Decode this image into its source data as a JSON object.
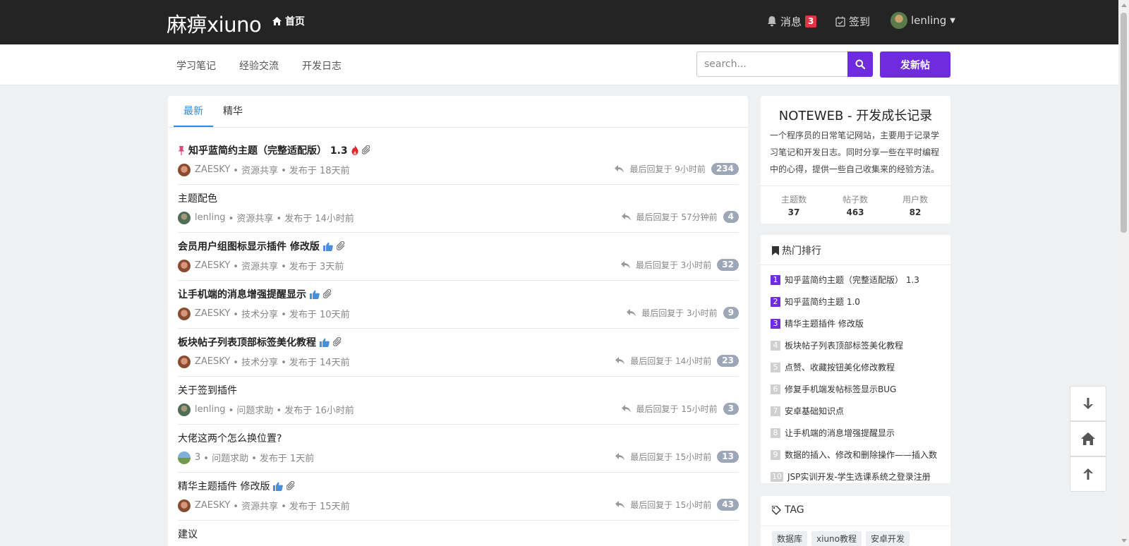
{
  "header": {
    "brand": "麻痹xiuno",
    "home_label": "首页",
    "messages_label": "消息",
    "messages_count": "3",
    "signin_label": "签到",
    "username": "lenling"
  },
  "subnav": {
    "items": [
      "学习笔记",
      "经验交流",
      "开发日志"
    ],
    "search_placeholder": "search...",
    "new_post_label": "发新帖"
  },
  "tabs": [
    "最新",
    "精华"
  ],
  "threads": [
    {
      "title": "知乎蓝简约主题（完整适配版） 1.3",
      "bold": true,
      "pinned": true,
      "hot": true,
      "attach": true,
      "thumb": false,
      "author": "ZAESKY",
      "avatar": "z",
      "forum": "• 资源共享 •",
      "posted": "发布于 18天前",
      "last_reply": "最后回复于 9小时前",
      "count": "234"
    },
    {
      "title": "主题配色",
      "bold": false,
      "pinned": false,
      "hot": false,
      "attach": false,
      "thumb": false,
      "author": "lenling",
      "avatar": "l",
      "forum": "• 资源共享 •",
      "posted": "发布于 14小时前",
      "last_reply": "最后回复于 57分钟前",
      "count": "4"
    },
    {
      "title": "会员用户组图标显示插件 修改版",
      "bold": true,
      "pinned": false,
      "hot": false,
      "attach": true,
      "thumb": true,
      "author": "ZAESKY",
      "avatar": "z",
      "forum": "• 资源共享 •",
      "posted": "发布于 3天前",
      "last_reply": "最后回复于 3小时前",
      "count": "32"
    },
    {
      "title": "让手机端的消息增强提醒显示",
      "bold": true,
      "pinned": false,
      "hot": false,
      "attach": true,
      "thumb": true,
      "author": "ZAESKY",
      "avatar": "z",
      "forum": "• 技术分享 •",
      "posted": "发布于 10天前",
      "last_reply": "最后回复于 3小时前",
      "count": "9"
    },
    {
      "title": "板块帖子列表顶部标签美化教程",
      "bold": true,
      "pinned": false,
      "hot": false,
      "attach": true,
      "thumb": true,
      "author": "ZAESKY",
      "avatar": "z",
      "forum": "• 技术分享 •",
      "posted": "发布于 14天前",
      "last_reply": "最后回复于 14小时前",
      "count": "23"
    },
    {
      "title": "关于签到插件",
      "bold": false,
      "pinned": false,
      "hot": false,
      "attach": false,
      "thumb": false,
      "author": "lenling",
      "avatar": "l",
      "forum": "• 问题求助 •",
      "posted": "发布于 16小时前",
      "last_reply": "最后回复于 15小时前",
      "count": "3"
    },
    {
      "title": "大佬这两个怎么换位置?",
      "bold": false,
      "pinned": false,
      "hot": false,
      "attach": false,
      "thumb": false,
      "author": "3",
      "avatar": "3",
      "forum": "• 问题求助 •",
      "posted": "发布于 1天前",
      "last_reply": "最后回复于 15小时前",
      "count": "13"
    },
    {
      "title": "精华主题插件 修改版",
      "bold": false,
      "pinned": false,
      "hot": false,
      "attach": true,
      "thumb": true,
      "author": "ZAESKY",
      "avatar": "z",
      "forum": "• 资源共享 •",
      "posted": "发布于 15天前",
      "last_reply": "最后回复于 15小时前",
      "count": "43"
    },
    {
      "title": "建议",
      "bold": false,
      "pinned": false,
      "hot": false,
      "attach": false,
      "thumb": false,
      "author": "",
      "avatar": "",
      "forum": "",
      "posted": "",
      "last_reply": "",
      "count": ""
    }
  ],
  "about": {
    "title": "NOTEWEB - 开发成长记录",
    "description": "一个程序员的日常笔记网站，主要用于记录学习笔记和开发日志。同时分享一些在平时编程中的心得，提供一些自己收集来的经验方法。",
    "stats": [
      {
        "label": "主题数",
        "value": "37"
      },
      {
        "label": "帖子数",
        "value": "463"
      },
      {
        "label": "用户数",
        "value": "82"
      }
    ]
  },
  "hot_ranking": {
    "title": "热门排行",
    "items": [
      {
        "rank": "1",
        "title": "知乎蓝简约主题（完整适配版） 1.3"
      },
      {
        "rank": "2",
        "title": "知乎蓝简约主题 1.0"
      },
      {
        "rank": "3",
        "title": "精华主题插件 修改版"
      },
      {
        "rank": "4",
        "title": "板块帖子列表顶部标签美化教程"
      },
      {
        "rank": "5",
        "title": "点赞、收藏按钮美化修改教程"
      },
      {
        "rank": "6",
        "title": "修复手机端发帖标签显示BUG"
      },
      {
        "rank": "7",
        "title": "安卓基础知识点"
      },
      {
        "rank": "8",
        "title": "让手机端的消息增强提醒显示"
      },
      {
        "rank": "9",
        "title": "数据的插入、修改和删除操作——插入数"
      },
      {
        "rank": "10",
        "title": "JSP实训开发-学生选课系统之登录注册"
      }
    ]
  },
  "tags": {
    "title": "TAG",
    "items": [
      "数据库",
      "xiuno教程",
      "安卓开发"
    ]
  },
  "colors": {
    "accent": "#6f2cde",
    "topbar": "#242424",
    "tab_active": "#2b8ae6",
    "badge_red": "#dc3545"
  }
}
